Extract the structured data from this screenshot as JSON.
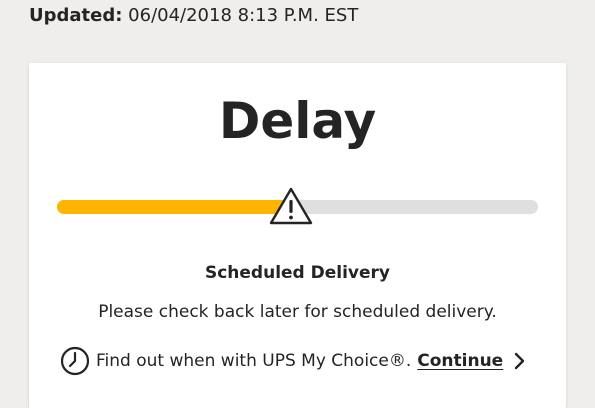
{
  "header": {
    "updated_label": "Updated:",
    "updated_value": "06/04/2018 8:13 P.M. EST"
  },
  "status": {
    "title": "Delay",
    "progress_fraction": 0.48,
    "progress_color": "#ffb500",
    "track_color": "#dfdfdd",
    "indicator_icon": "warning-icon"
  },
  "scheduled_delivery": {
    "heading": "Scheduled Delivery",
    "message": "Please check back later for scheduled delivery."
  },
  "my_choice": {
    "icon": "clock-icon",
    "text": "Find out when with UPS My Choice®.",
    "link_label": "Continue",
    "link_icon": "chevron-right-icon"
  }
}
